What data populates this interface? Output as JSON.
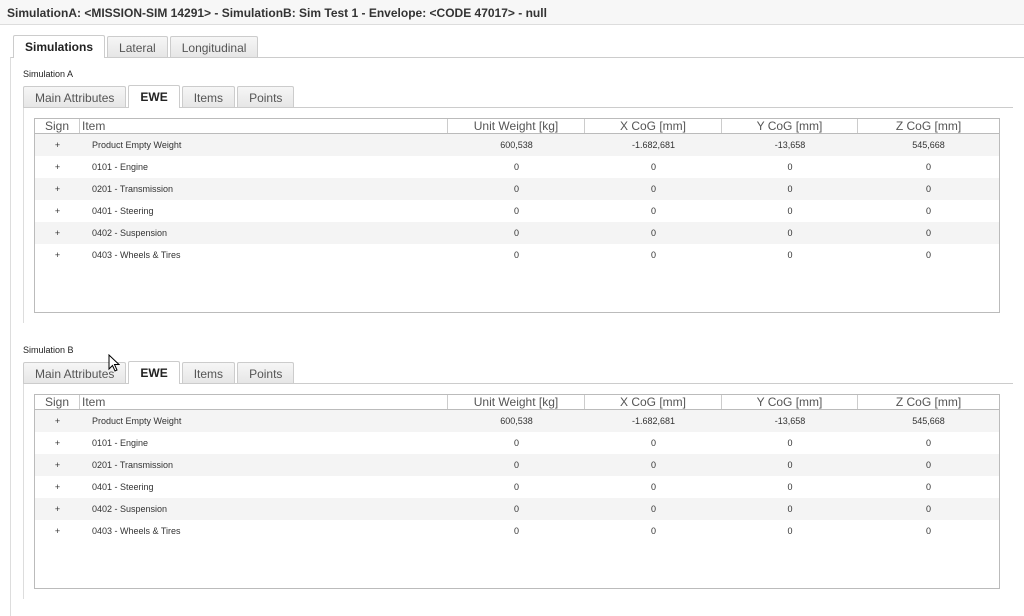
{
  "title": "SimulationA: <MISSION-SIM 14291> - SimulationB: Sim Test 1 - Envelope: <CODE 47017> - null",
  "outer_tabs": [
    "Simulations",
    "Lateral",
    "Longitudinal"
  ],
  "inner_tabs": [
    "Main Attributes",
    "EWE",
    "Items",
    "Points"
  ],
  "columns": [
    "Sign",
    "Item",
    "Unit Weight [kg]",
    "X CoG [mm]",
    "Y CoG [mm]",
    "Z CoG [mm]"
  ],
  "sections": [
    {
      "label": "Simulation A",
      "rows": [
        [
          "+",
          "Product Empty Weight",
          "600,538",
          "-1.682,681",
          "-13,658",
          "545,668"
        ],
        [
          "+",
          "0101 - Engine",
          "0",
          "0",
          "0",
          "0"
        ],
        [
          "+",
          "0201 - Transmission",
          "0",
          "0",
          "0",
          "0"
        ],
        [
          "+",
          "0401 - Steering",
          "0",
          "0",
          "0",
          "0"
        ],
        [
          "+",
          "0402 - Suspension",
          "0",
          "0",
          "0",
          "0"
        ],
        [
          "+",
          "0403 - Wheels & Tires",
          "0",
          "0",
          "0",
          "0"
        ]
      ]
    },
    {
      "label": "Simulation B",
      "rows": [
        [
          "+",
          "Product Empty Weight",
          "600,538",
          "-1.682,681",
          "-13,658",
          "545,668"
        ],
        [
          "+",
          "0101 - Engine",
          "0",
          "0",
          "0",
          "0"
        ],
        [
          "+",
          "0201 - Transmission",
          "0",
          "0",
          "0",
          "0"
        ],
        [
          "+",
          "0401 - Steering",
          "0",
          "0",
          "0",
          "0"
        ],
        [
          "+",
          "0402 - Suspension",
          "0",
          "0",
          "0",
          "0"
        ],
        [
          "+",
          "0403 - Wheels & Tires",
          "0",
          "0",
          "0",
          "0"
        ]
      ]
    }
  ]
}
